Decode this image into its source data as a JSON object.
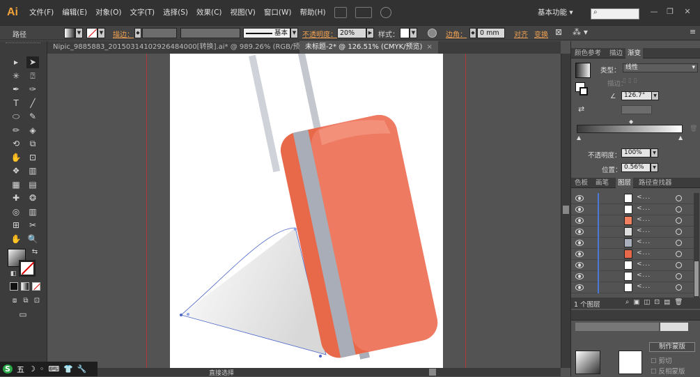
{
  "app": {
    "logo": "Ai"
  },
  "menu": [
    "文件(F)",
    "编辑(E)",
    "对象(O)",
    "文字(T)",
    "选择(S)",
    "效果(C)",
    "视图(V)",
    "窗口(W)",
    "帮助(H)"
  ],
  "workspace": {
    "label": "基本功能",
    "arrow": "▾"
  },
  "search": {
    "icon": "search-icon",
    "value": ""
  },
  "window_controls": [
    "—",
    "❐",
    "✕"
  ],
  "control_bar": {
    "object_type": "路径",
    "stroke_label": "描边：",
    "stroke_style": "基本",
    "opacity_label": "不透明度：",
    "opacity_value": "20%",
    "style_label": "样式：",
    "corner_label": "边角：",
    "corner_value": "0 mm",
    "align_label": "对齐",
    "transform_label": "变换"
  },
  "tabs": [
    {
      "label": "Nipic_9885883_20150314102926484000[转换].ai* @ 989.26% (RGB/预览)",
      "close": "×",
      "active": false
    },
    {
      "label": "未标题-2* @ 126.51% (CMYK/预览)",
      "close": "×",
      "active": true
    }
  ],
  "tools": [
    "▸",
    "➤",
    "✳",
    "⍰",
    "✒",
    "✑",
    "T",
    "╱",
    "⬭",
    "✎",
    "✏",
    "◈",
    "⟲",
    "⧉",
    "✋",
    "⊡",
    "❖",
    "▥",
    "▦",
    "▤",
    "✚",
    "❂",
    "◎",
    "▥",
    "⊞",
    "✂",
    "✋",
    "🔍"
  ],
  "gradient_panel": {
    "tabs": [
      "颜色参考",
      "描边",
      "渐变"
    ],
    "type_label": "类型：",
    "type_value": "线性",
    "stroke_label": "描边：",
    "angle_value": "126.7°",
    "opacity_label": "不透明度：",
    "opacity_value": "100%",
    "position_label": "位置：",
    "position_value": "0.56%",
    "gradient_start": "#3a3a3a",
    "gradient_end": "#ffffff"
  },
  "layers_panel": {
    "tabs": [
      "色板",
      "画笔",
      "图层",
      "路径查找器"
    ],
    "rows": [
      {
        "name": "<...",
        "thumb": "#ffffff"
      },
      {
        "name": "<...",
        "thumb": "#ffffff"
      },
      {
        "name": "<...",
        "thumb": "#f08060"
      },
      {
        "name": "<...",
        "thumb": "#dddddd"
      },
      {
        "name": "<...",
        "thumb": "#aab0be"
      },
      {
        "name": "<...",
        "thumb": "#e8684a"
      },
      {
        "name": "<...",
        "thumb": "#ffffff"
      },
      {
        "name": "<...",
        "thumb": "#ffffff"
      },
      {
        "name": "<...",
        "thumb": "#ffffff"
      }
    ],
    "count": "1 个图层"
  },
  "lower_panel": {
    "make_mask": "制作蒙版",
    "clip": "剪切",
    "invert_mask": "反相蒙版"
  },
  "status": {
    "tool": "直接选择"
  },
  "taskbar": [
    "S",
    "五",
    "☽",
    "◦",
    "⌨",
    "👕",
    "🔧"
  ],
  "colors": {
    "suitcase": "#e8684a",
    "suitcase_light": "#f08068",
    "suitcase_top": "#f3907a",
    "stripe": "#a9adb8",
    "handle": "#cfd2d8",
    "path": "#4a64c8"
  }
}
